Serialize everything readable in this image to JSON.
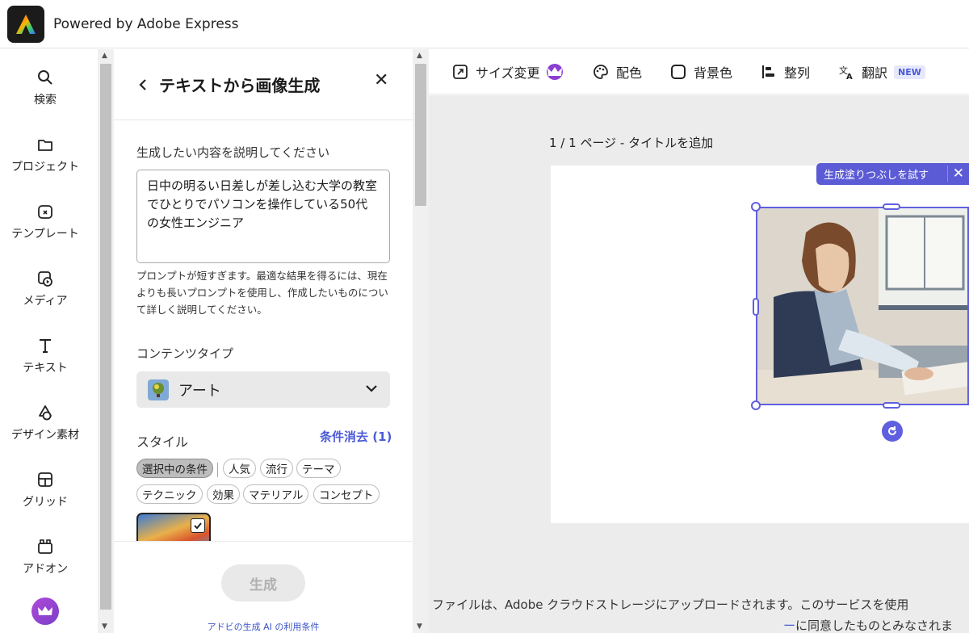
{
  "header": {
    "brand": "Powered by Adobe Express"
  },
  "leftnav": {
    "items": [
      {
        "label": "検索",
        "icon": "search-icon"
      },
      {
        "label": "プロジェクト",
        "icon": "folder-icon"
      },
      {
        "label": "テンプレート",
        "icon": "template-icon"
      },
      {
        "label": "メディア",
        "icon": "media-icon"
      },
      {
        "label": "テキスト",
        "icon": "text-icon"
      },
      {
        "label": "デザイン素材",
        "icon": "shapes-icon"
      },
      {
        "label": "グリッド",
        "icon": "grid-icon"
      },
      {
        "label": "アドオン",
        "icon": "addon-icon"
      }
    ]
  },
  "panel": {
    "title": "テキストから画像生成",
    "prompt_label": "生成したい内容を説明してください",
    "prompt_value": "日中の明るい日差しが差し込む大学の教室でひとりでパソコンを操作している50代の女性エンジニア",
    "hint": "プロンプトが短すぎます。最適な結果を得るには、現在よりも長いプロンプトを使用し、作成したいものについて詳しく説明してください。",
    "content_type_label": "コンテンツタイプ",
    "content_type_value": "アート",
    "style_label": "スタイル",
    "clear_filters": "条件消去 (1)",
    "chips": [
      "選択中の条件",
      "人気",
      "流行",
      "テーマ",
      "テクニック",
      "効果",
      "マテリアル",
      "コンセプト"
    ],
    "generate_label": "生成",
    "terms": "アドビの生成 AI の利用条件"
  },
  "toolbar": {
    "resize": "サイズ変更",
    "color": "配色",
    "background": "背景色",
    "align": "整列",
    "translate": "翻訳",
    "new_badge": "NEW"
  },
  "canvas": {
    "page_label": "1 / 1 ページ - タイトルを追加",
    "fill_banner": "生成塗りつぶしを試す",
    "footnote": "ファイルは、Adobe クラウドストレージにアップロードされます。このサービスを使用",
    "footnote2_link": "ー",
    "footnote2": "に同意したものとみなされま"
  },
  "colors": {
    "accent": "#5b5bd6",
    "link": "#4b5bd6",
    "premium": "#8b3fd0"
  }
}
